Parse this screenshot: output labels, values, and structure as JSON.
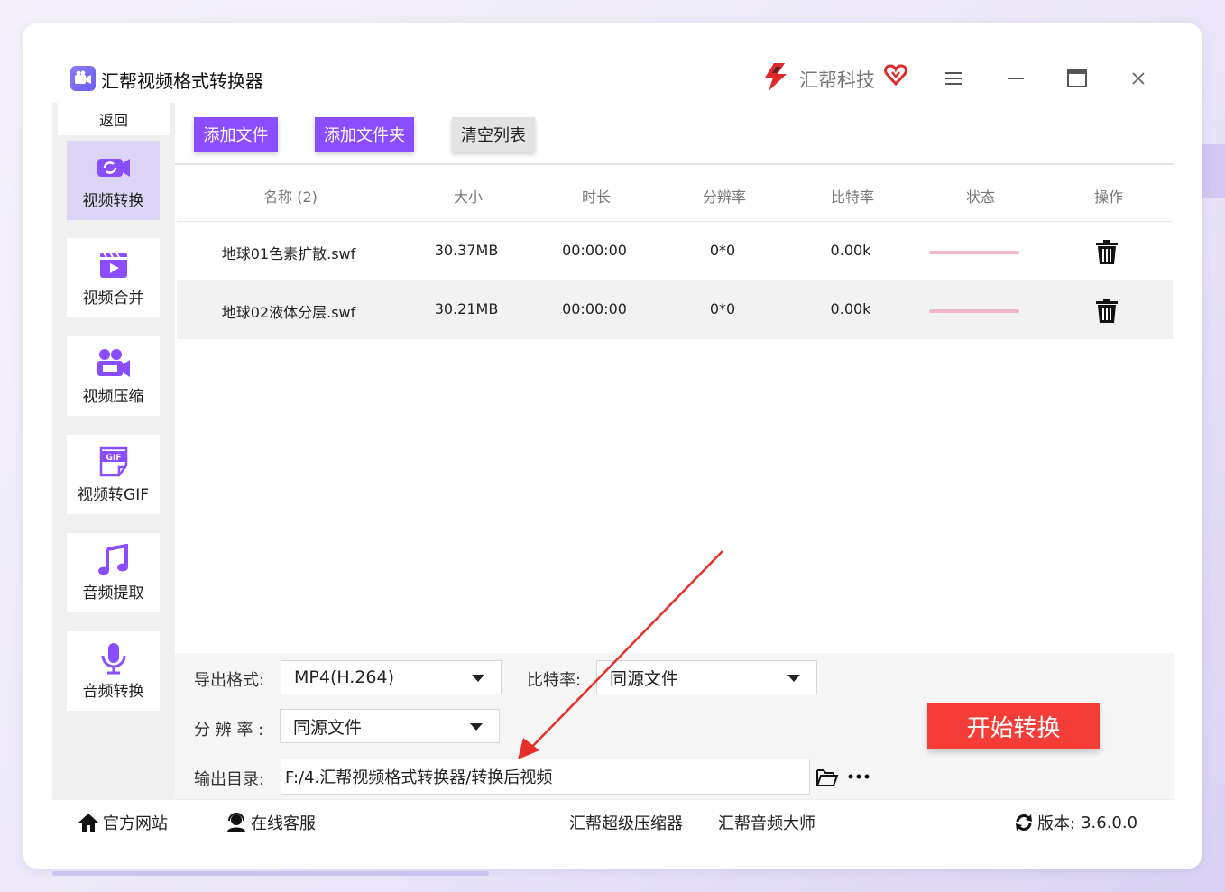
{
  "window": {
    "title": "汇帮视频格式转换器",
    "brand": "汇帮科技"
  },
  "sidebar": {
    "back_label": "返回",
    "items": [
      {
        "label": "视频转换",
        "icon": "video-convert-icon",
        "active": true
      },
      {
        "label": "视频合并",
        "icon": "video-merge-icon",
        "active": false
      },
      {
        "label": "视频压缩",
        "icon": "video-compress-icon",
        "active": false
      },
      {
        "label": "视频转GIF",
        "icon": "gif-icon",
        "active": false
      },
      {
        "label": "音频提取",
        "icon": "music-note-icon",
        "active": false
      },
      {
        "label": "音频转换",
        "icon": "microphone-icon",
        "active": false
      }
    ]
  },
  "toolbar": {
    "add_file": "添加文件",
    "add_folder": "添加文件夹",
    "clear_list": "清空列表"
  },
  "table": {
    "headers": [
      "名称 (2)",
      "大小",
      "时长",
      "分辨率",
      "比特率",
      "状态",
      "操作"
    ],
    "rows": [
      {
        "name": "地球01色素扩散.swf",
        "size": "30.37MB",
        "duration": "00:00:00",
        "resolution": "0*0",
        "bitrate": "0.00k",
        "progress": 0
      },
      {
        "name": "地球02液体分层.swf",
        "size": "30.21MB",
        "duration": "00:00:00",
        "resolution": "0*0",
        "bitrate": "0.00k",
        "progress": 0
      }
    ]
  },
  "settings": {
    "format_label": "导出格式:",
    "format_value": "MP4(H.264)",
    "bitrate_label": "比特率:",
    "bitrate_value": "同源文件",
    "resolution_label": "分 辨 率 :",
    "resolution_value": "同源文件",
    "output_label": "输出目录:",
    "output_path": "F:/4.汇帮视频格式转换器/转换后视频",
    "start_button": "开始转换"
  },
  "footer": {
    "website": "官方网站",
    "support": "在线客服",
    "compressor": "汇帮超级压缩器",
    "audio_master": "汇帮音频大师",
    "version_label": "版本:",
    "version_value": "3.6.0.0"
  },
  "colors": {
    "accent": "#8a4dff",
    "start_button": "#f53d37",
    "sidebar_active": "#dcd5f5",
    "annotation_arrow": "#e8302a"
  }
}
